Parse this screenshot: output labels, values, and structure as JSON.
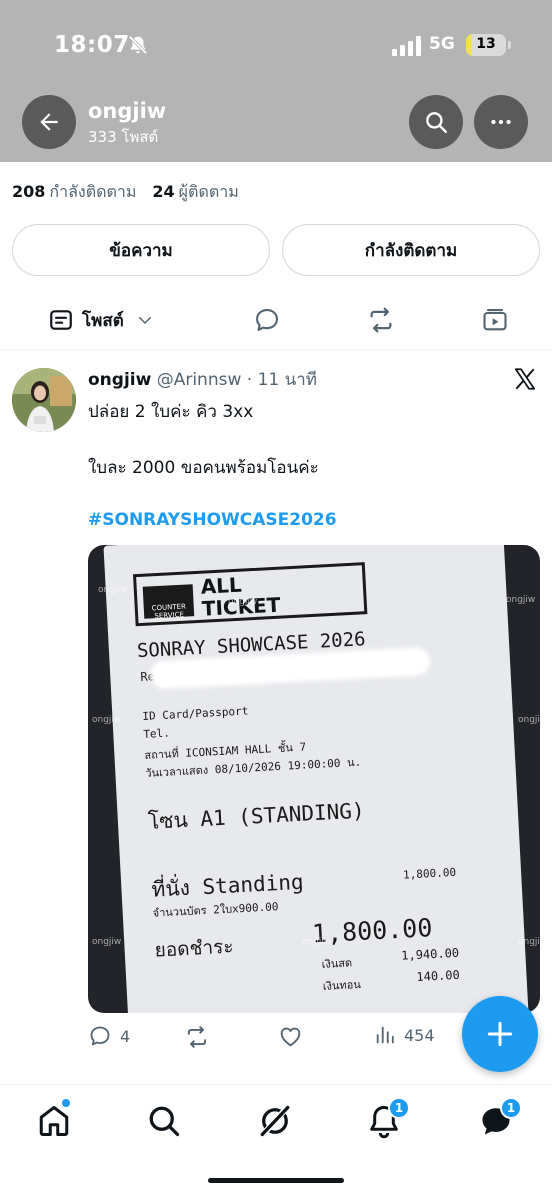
{
  "status": {
    "time": "18:07",
    "network": "5G",
    "battery": "13",
    "battery_level": 0.13,
    "icons": [
      "bell-muted-icon",
      "signal-icon"
    ]
  },
  "profile": {
    "name": "ongjiw",
    "post_count": "333 โพสต์",
    "following_count": "208",
    "following_label": "กำลังติดตาม",
    "followers_count": "24",
    "followers_label": "ผู้ติดตาม"
  },
  "actions": {
    "message_label": "ข้อความ",
    "following_label": "กำลังติดตาม"
  },
  "tabs": {
    "posts_label": "โพสต์",
    "icons": [
      "posts-icon",
      "replies-icon",
      "reposts-icon",
      "media-icon"
    ]
  },
  "post": {
    "author_name": "ongjiw",
    "author_meta": "@Arinnsw · 11 นาที",
    "line1": "ปล่อย 2 ใบค่ะ คิว 3xx",
    "line2": "ใบละ 2000 ขอคนพร้อมโอนค่ะ",
    "hashtag": "#SONRAYSHOWCASE2026",
    "reply_count": "4",
    "view_count": "454",
    "ticket": {
      "brand_small": "COUNTER SERVICE",
      "brand_line1": "ALL",
      "brand_line2": "TICKET",
      "event": "SONRAY SHOWCASE 2026",
      "reserve_id": "Reserve ID",
      "id_card": "ID Card/Passport",
      "tel": "Tel.",
      "venue": "สถานที่ ICONSIAM HALL ชั้น 7",
      "datetime": "วันเวลาแสดง 08/10/2026 19:00:00 น.",
      "zone": "โซน A1 (STANDING)",
      "seat": "ที่นั่ง Standing",
      "seat_price": "1,800.00",
      "qty": "จำนวนบัตร 2ใบx900.00",
      "total_label": "ยอดชำระ",
      "total": "1,800.00",
      "cash_label": "เงินสด",
      "cash": "1,940.00",
      "change_label": "เงินทอน",
      "change": "140.00",
      "watermark": "ongjiw"
    }
  },
  "bottom_nav": {
    "notifications_badge": "1",
    "messages_badge": "1",
    "icons": [
      "home-icon",
      "search-icon",
      "grok-icon",
      "bell-icon",
      "messages-icon"
    ]
  },
  "colors": {
    "accent": "#1d9bf0",
    "header_bg": "#b4b4b4",
    "muted_text": "#536471"
  }
}
